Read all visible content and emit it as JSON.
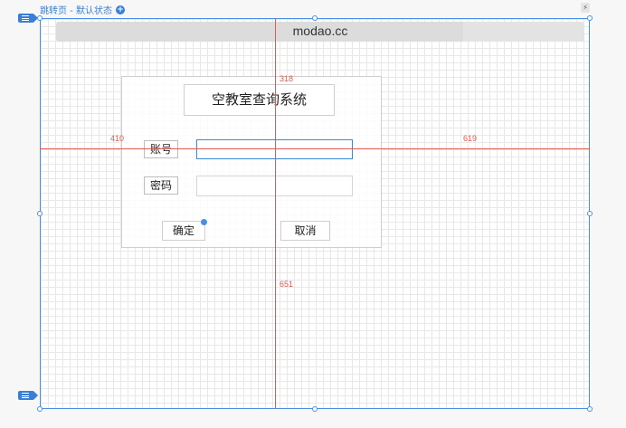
{
  "page": {
    "state_title": "跳转页 - 默认状态",
    "state_add_glyph": "+",
    "lightning_glyph": "⚡",
    "url": "modao.cc"
  },
  "form": {
    "title": "空教室查询系统",
    "account_label": "账号",
    "account_value": "",
    "password_label": "密码",
    "password_value": "",
    "confirm_label": "确定",
    "cancel_label": "取消"
  },
  "measurements": {
    "top": "318",
    "left": "410",
    "right": "619",
    "bottom": "651"
  },
  "colors": {
    "accent": "#3a7fd6",
    "guide": "#e05a4f"
  }
}
